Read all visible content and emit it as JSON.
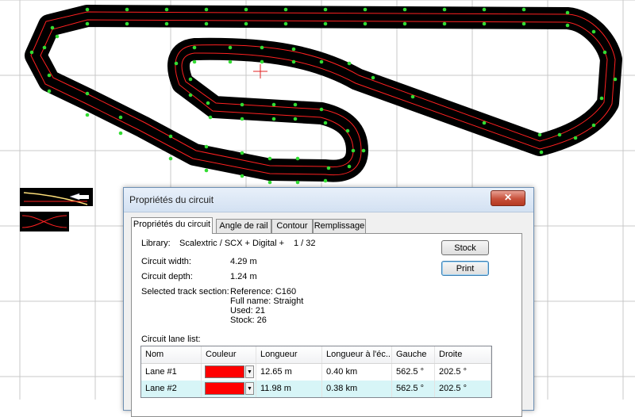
{
  "dialog": {
    "title": "Propriétés du circuit",
    "close_label": "✕",
    "tabs": [
      {
        "label": "Propriétés du circuit"
      },
      {
        "label": "Angle de rail"
      },
      {
        "label": "Contour"
      },
      {
        "label": "Remplissage"
      }
    ],
    "library_label": "Library:",
    "library_value": "Scalextric / SCX + Digital +",
    "library_page": "1 / 32",
    "width_label": "Circuit width:",
    "width_value": "4.29 m",
    "depth_label": "Circuit depth:",
    "depth_value": "1.24 m",
    "section_label": "Selected track section:",
    "section_reference": "Reference: C160",
    "section_fullname": "Full name: Straight",
    "section_used": "Used: 21",
    "section_stock": "Stock: 26",
    "lane_list_label": "Circuit lane list:",
    "stock_button": "Stock",
    "print_button": "Print",
    "lane_columns": [
      "Nom",
      "Couleur",
      "Longueur",
      "Longueur à l'éc...",
      "Gauche",
      "Droite"
    ],
    "lanes": [
      {
        "name": "Lane #1",
        "color": "#ff0000",
        "length": "12.65 m",
        "scale_length": "0.40 km",
        "left": "562.5 °",
        "right": "202.5 °"
      },
      {
        "name": "Lane #2",
        "color": "#ff0000",
        "length": "11.98 m",
        "scale_length": "0.38 km",
        "left": "562.5 °",
        "right": "202.5 °"
      }
    ]
  },
  "colors": {
    "track": "#000000",
    "lane": "#ff0000",
    "joint": "#33dd33",
    "grid": "#c8c8c8",
    "crosshair": "#e02020"
  }
}
